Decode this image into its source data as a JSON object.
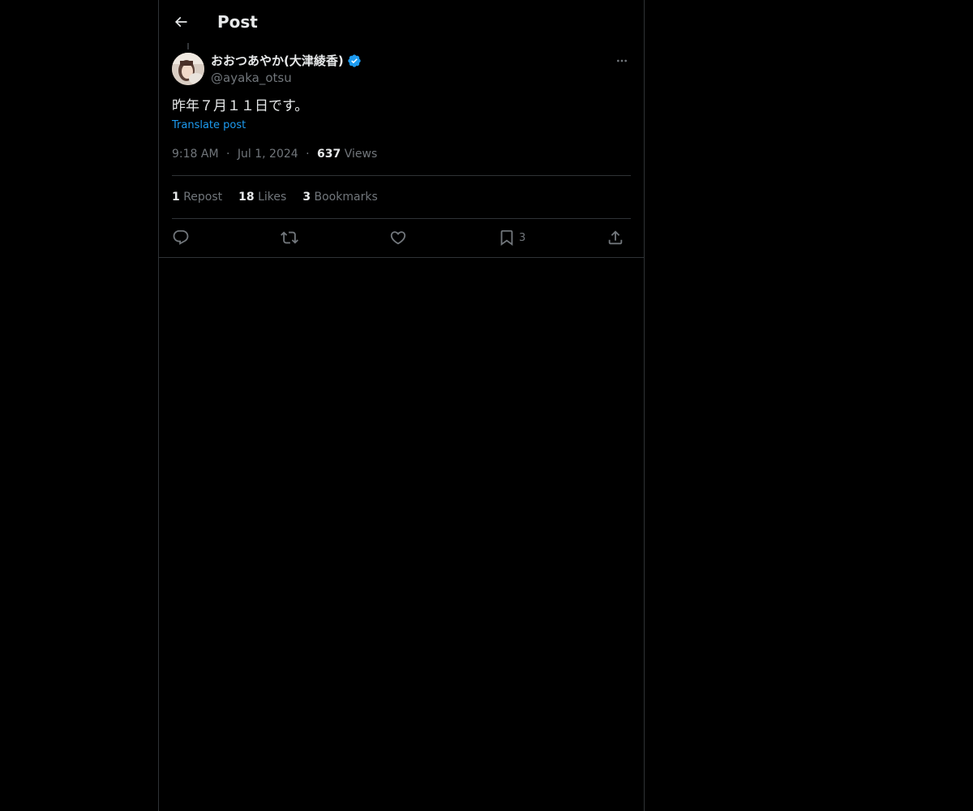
{
  "header": {
    "title": "Post",
    "back_icon": "arrow-left-icon"
  },
  "author": {
    "display_name": "おおつあやか(大津綾香)",
    "handle": "@ayaka_otsu",
    "verified": true,
    "verified_color": "#1d9bf0"
  },
  "post": {
    "text": "昨年７月１１日です。",
    "translate_label": "Translate post",
    "time": "9:18 AM",
    "separator": "·",
    "date": "Jul 1, 2024",
    "views_count": "637",
    "views_label": "Views"
  },
  "stats": {
    "reposts_count": "1",
    "reposts_label": "Repost",
    "likes_count": "18",
    "likes_label": "Likes",
    "bookmarks_count": "3",
    "bookmarks_label": "Bookmarks"
  },
  "actions": {
    "reply_icon": "reply-icon",
    "repost_icon": "repost-icon",
    "like_icon": "heart-icon",
    "bookmark_icon": "bookmark-icon",
    "bookmark_count": "3",
    "share_icon": "share-icon"
  },
  "colors": {
    "background": "#000000",
    "text_primary": "#e7e9ea",
    "text_secondary": "#71767b",
    "accent": "#1d9bf0",
    "border": "#2f3336"
  }
}
